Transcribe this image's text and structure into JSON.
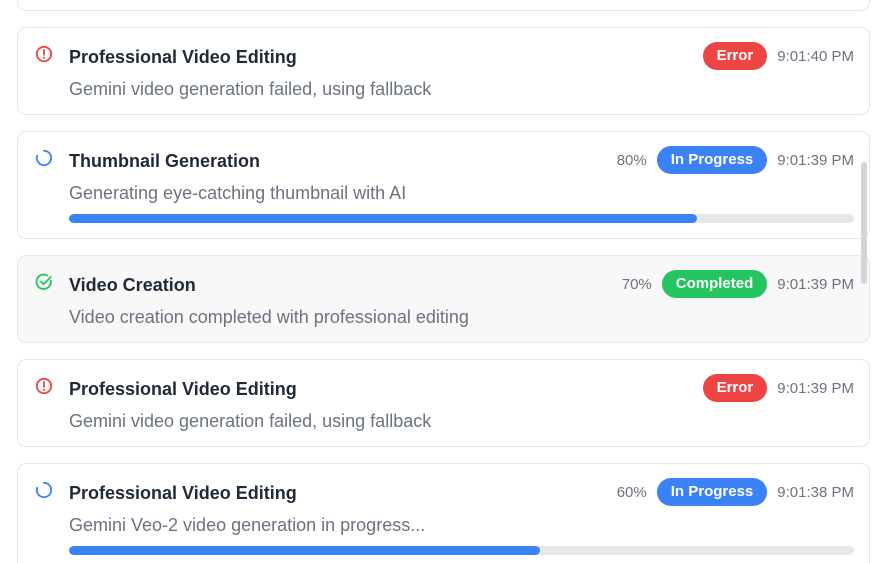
{
  "colors": {
    "error": "#ef4444",
    "in_progress": "#3b82f6",
    "completed": "#22c55e",
    "text_primary": "#1f2937",
    "text_secondary": "#6b7280"
  },
  "events": [
    {
      "status": "error",
      "icon": "alert-circle-icon",
      "title": "Professional Video Editing",
      "message": "Gemini video generation failed, using fallback",
      "badge": "Error",
      "time": "9:01:40 PM"
    },
    {
      "status": "in_progress",
      "icon": "loading-spinner-icon",
      "title": "Thumbnail Generation",
      "message": "Generating eye-catching thumbnail with AI",
      "percent": "80%",
      "progress": 0.8,
      "badge": "In Progress",
      "time": "9:01:39 PM"
    },
    {
      "status": "completed",
      "icon": "check-circle-icon",
      "title": "Video Creation",
      "message": "Video creation completed with professional editing",
      "percent": "70%",
      "badge": "Completed",
      "time": "9:01:39 PM"
    },
    {
      "status": "error",
      "icon": "alert-circle-icon",
      "title": "Professional Video Editing",
      "message": "Gemini video generation failed, using fallback",
      "badge": "Error",
      "time": "9:01:39 PM"
    },
    {
      "status": "in_progress",
      "icon": "loading-spinner-icon",
      "title": "Professional Video Editing",
      "message": "Gemini Veo-2 video generation in progress...",
      "percent": "60%",
      "progress": 0.6,
      "badge": "In Progress",
      "time": "9:01:38 PM"
    }
  ]
}
